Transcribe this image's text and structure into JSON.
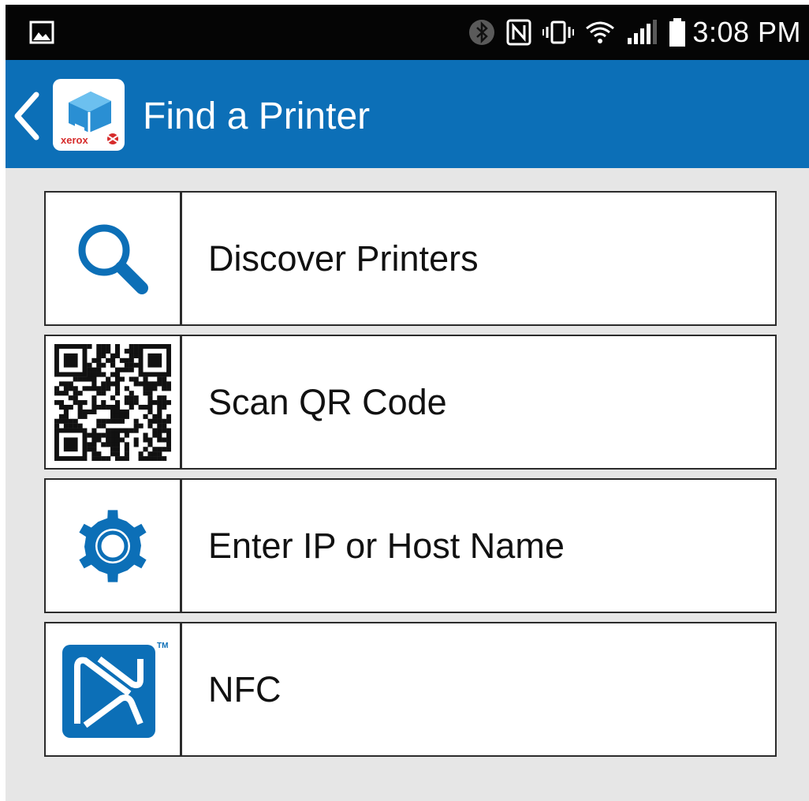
{
  "status_bar": {
    "time": "3:08 PM",
    "icons": [
      "gallery-icon",
      "bluetooth-icon",
      "nfc-icon",
      "vibrate-icon",
      "wifi-icon",
      "signal-icon",
      "battery-icon"
    ]
  },
  "app_bar": {
    "title": "Find a Printer",
    "back_icon": "chevron-left-icon",
    "logo_text": "xerox",
    "accent_color": "#0c6fb7"
  },
  "menu": {
    "items": [
      {
        "label": "Discover Printers",
        "icon": "search-icon"
      },
      {
        "label": "Scan QR Code",
        "icon": "qr-code-icon"
      },
      {
        "label": "Enter IP or Host Name",
        "icon": "gear-icon"
      },
      {
        "label": "NFC",
        "icon": "nfc-logo-icon",
        "icon_mark": "TM"
      }
    ]
  }
}
